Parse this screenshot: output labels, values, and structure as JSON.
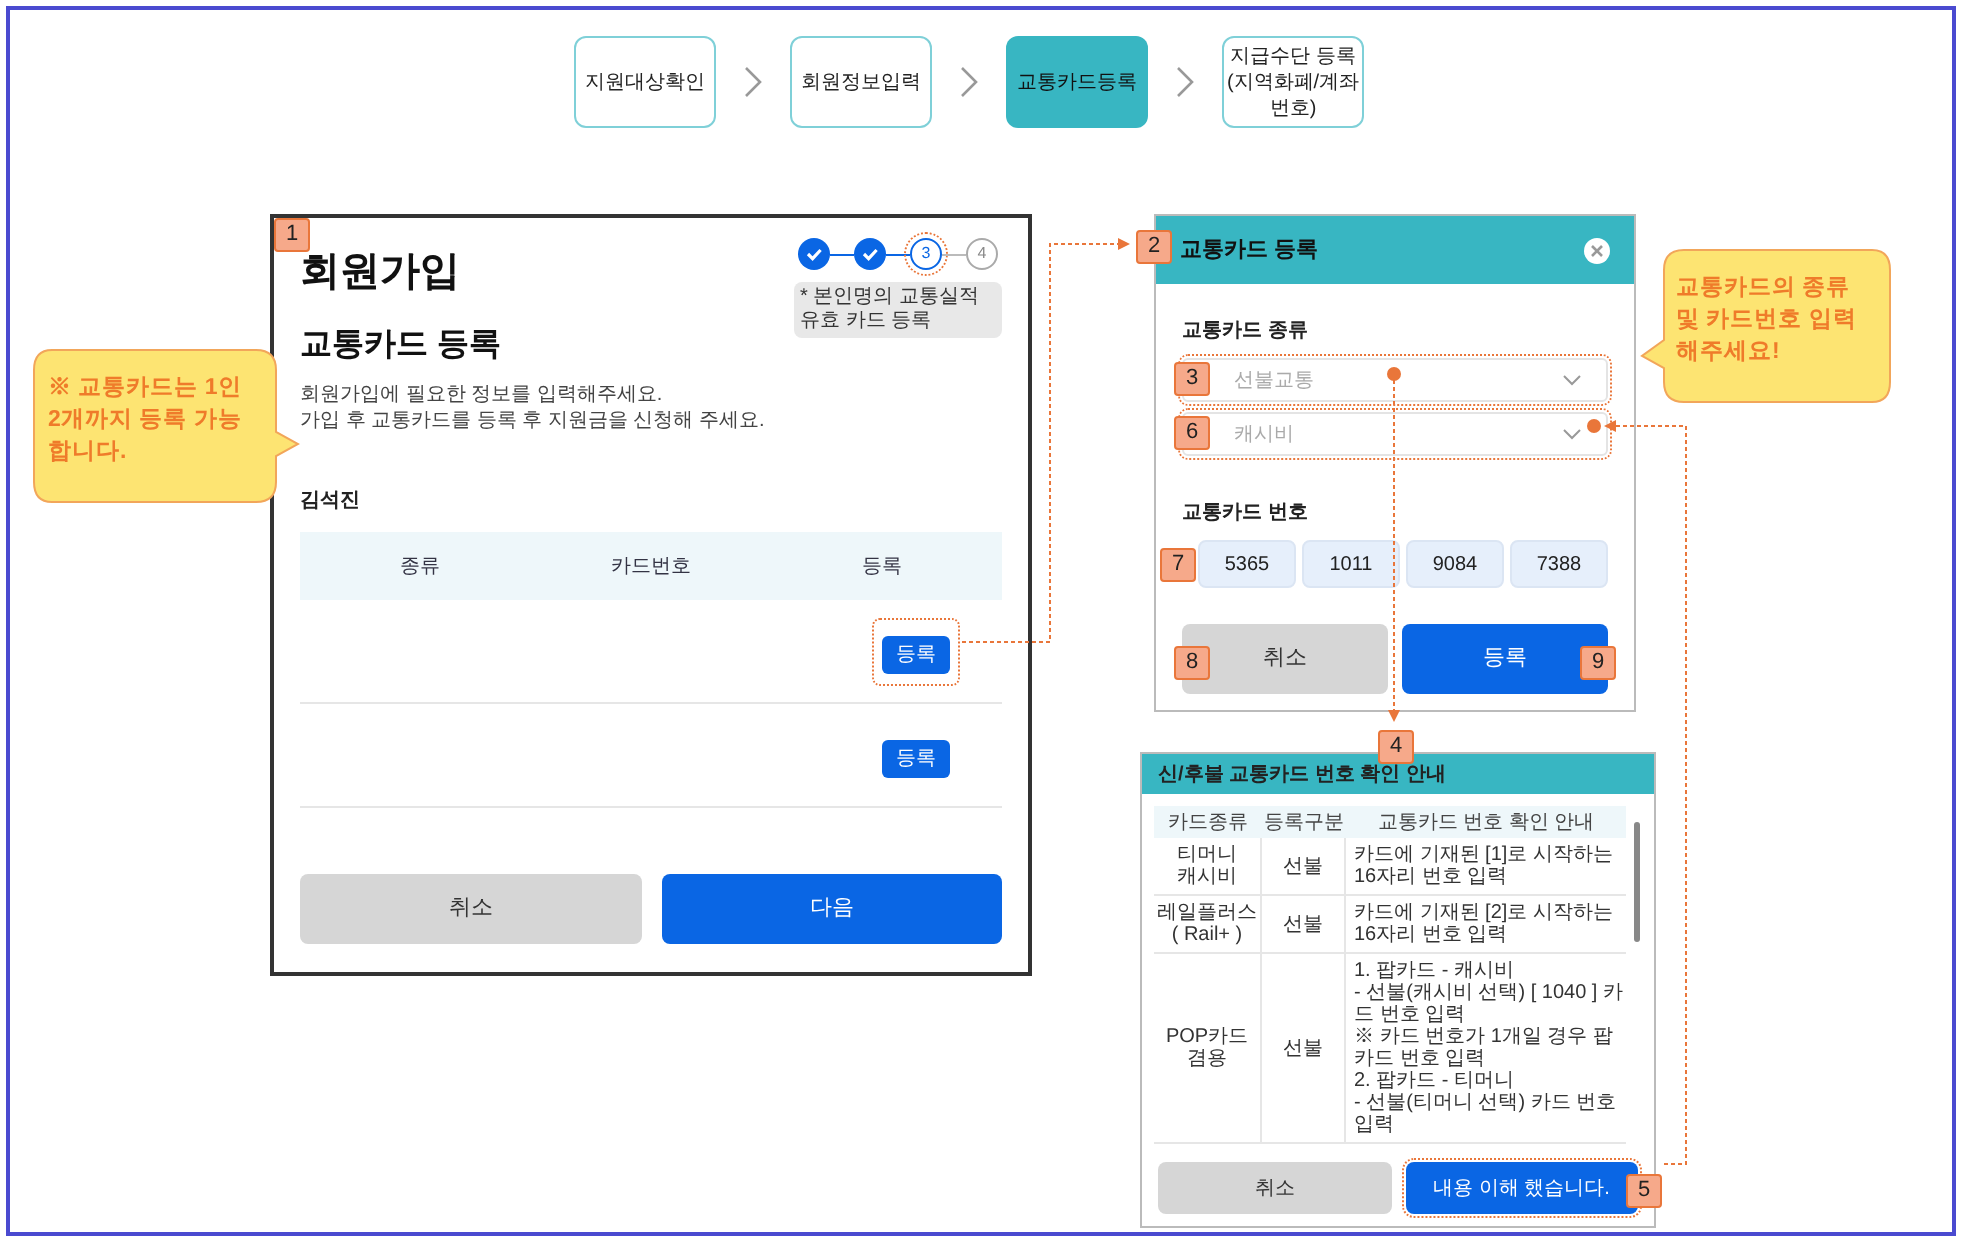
{
  "steps": [
    {
      "label": "지원대상확인",
      "selected": false
    },
    {
      "label": "회원정보입력",
      "selected": false
    },
    {
      "label": "교통카드등록",
      "selected": true
    },
    {
      "label": "지급수단 등록 (지역화폐/계좌 번호)",
      "selected": false
    }
  ],
  "signup": {
    "badge": "1",
    "title": "회원가입",
    "progress": [
      {
        "kind": "done",
        "highlighted": false
      },
      {
        "kind": "done",
        "highlighted": false
      },
      {
        "kind": "current",
        "label": "3",
        "highlighted": true
      },
      {
        "kind": "todo",
        "label": "4",
        "highlighted": false
      }
    ],
    "note": "* 본인명의 교통실적 유효 카드 등록",
    "heading": "교통카드 등록",
    "description": [
      "회원가입에 필요한 정보를 입력해주세요.",
      "가입 후 교통카드를 등록 후 지원금을 신청해 주세요."
    ],
    "user_name": "김석진",
    "table": {
      "columns": [
        "종류",
        "카드번호",
        "등록"
      ],
      "rows": [
        {
          "button": "등록",
          "highlighted": true
        },
        {
          "button": "등록",
          "highlighted": false
        }
      ]
    },
    "buttons": [
      {
        "label": "취소",
        "kind": "secondary"
      },
      {
        "label": "다음",
        "kind": "primary"
      }
    ]
  },
  "modal": {
    "badge": "2",
    "title": "교통카드 등록",
    "type_label": "교통카드 종류",
    "selects": [
      {
        "badge": "3",
        "placeholder": "선불교통",
        "highlighted": true
      },
      {
        "badge": "6",
        "placeholder": "캐시비",
        "highlighted": true
      }
    ],
    "number_label": "교통카드 번호",
    "number_badge": "7",
    "number_fields": [
      "5365",
      "1011",
      "9084",
      "7388"
    ],
    "buttons": [
      {
        "label": "취소",
        "kind": "secondary",
        "badge": "8"
      },
      {
        "label": "등록",
        "kind": "primary",
        "badge": "9"
      }
    ]
  },
  "guide": {
    "badge": "4",
    "title": "신/후불 교통카드 번호 확인 안내",
    "columns": [
      "카드종류",
      "등록구분",
      "교통카드 번호 확인 안내"
    ],
    "rows": [
      {
        "card": [
          "티머니",
          "캐시비"
        ],
        "type": "선불",
        "guide": [
          "카드에 기재된 [1]로 시작하는 16자리 번호 입력"
        ]
      },
      {
        "card": [
          "레일플러스",
          "( Rail+ )"
        ],
        "type": "선불",
        "guide": [
          "카드에 기재된 [2]로 시작하는 16자리 번호 입력"
        ]
      },
      {
        "card": [
          "POP카드 겸용"
        ],
        "type": "선불",
        "guide": [
          "1. 팝카드 - 캐시비",
          "- 선불(캐시비 선택) [ 1040 ] 카드 번호 입력",
          "※ 카드 번호가 1개일 경우 팝카드 번호 입력",
          "2. 팝카드 - 티머니",
          "- 선불(티머니 선택) 카드 번호 입력"
        ]
      }
    ],
    "buttons": [
      {
        "label": "취소",
        "kind": "secondary",
        "highlighted": false
      },
      {
        "label": "내용 이해 했습니다.",
        "kind": "primary",
        "highlighted": true,
        "badge": "5"
      }
    ]
  },
  "callouts": [
    {
      "text": "※ 교통카드는 1인 2개까지 등록 가능합니다.",
      "kind": "right"
    },
    {
      "text": "교통카드의 종류 및 카드번호 입력 해주세요!",
      "kind": "left"
    }
  ]
}
